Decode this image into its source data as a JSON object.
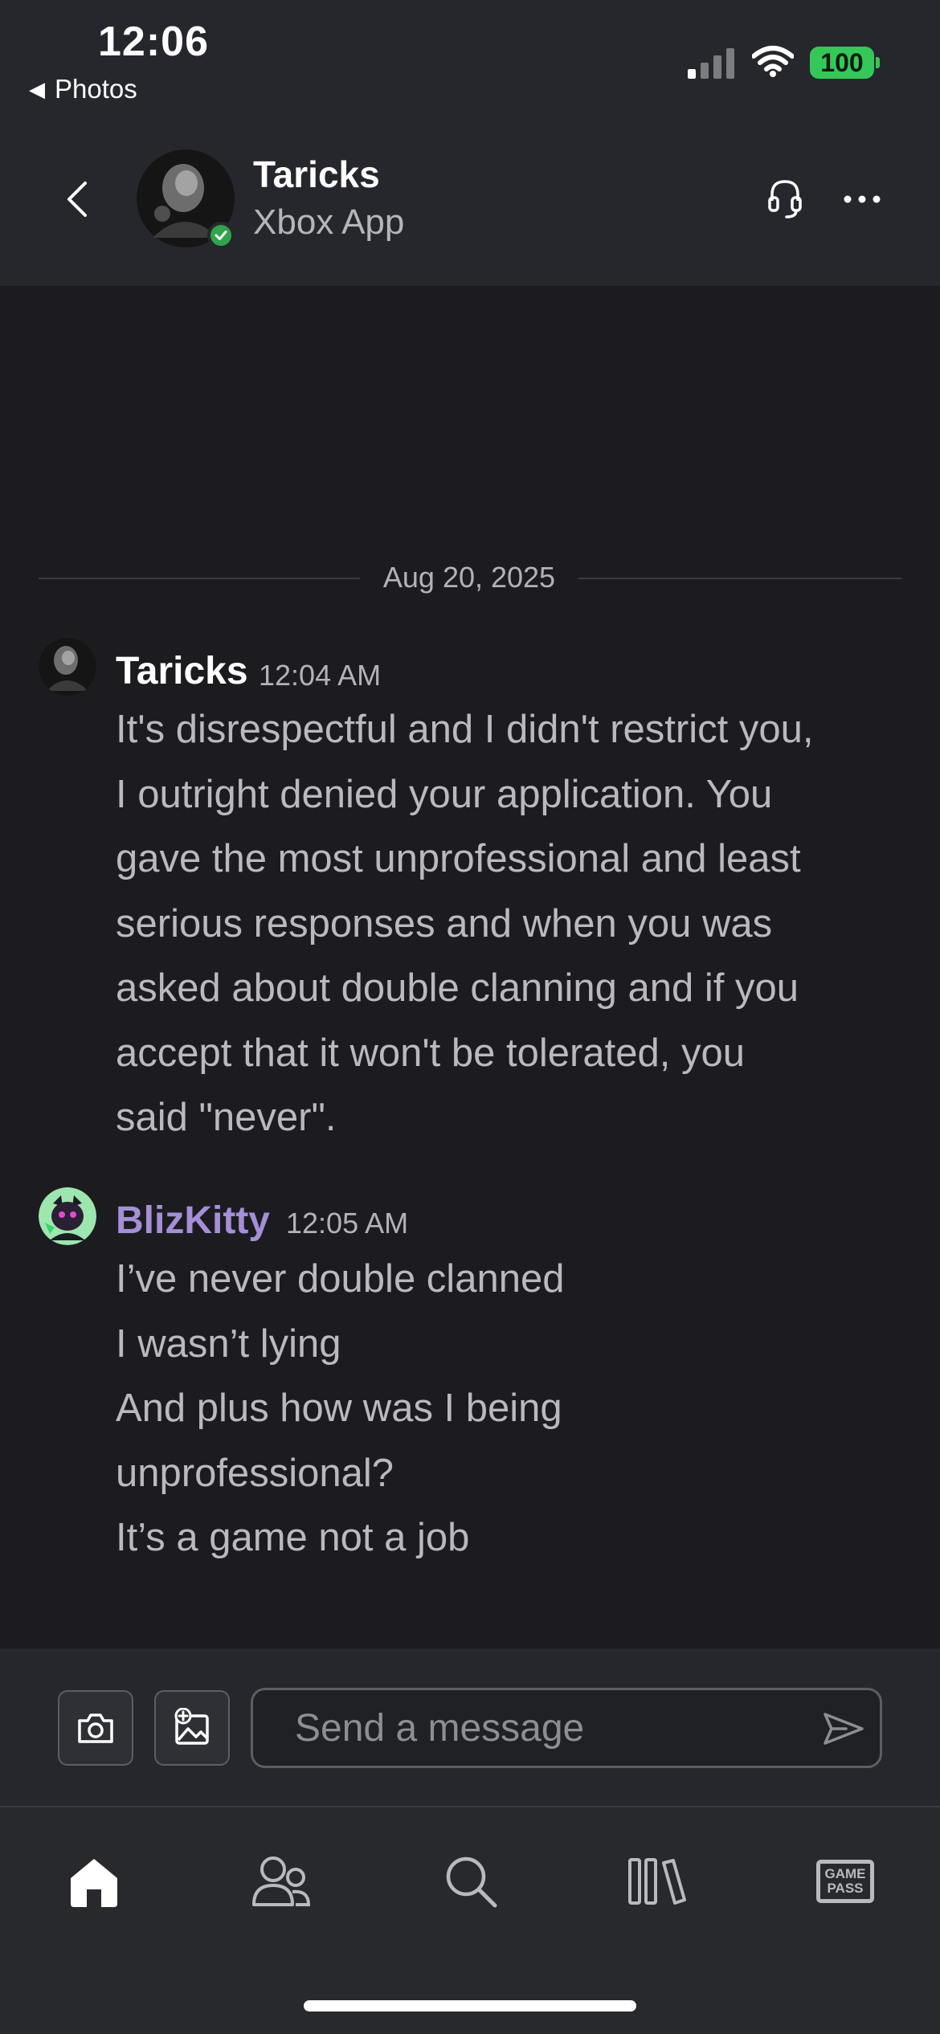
{
  "status_bar": {
    "time": "12:06",
    "back_app": "Photos",
    "battery": "100"
  },
  "header": {
    "name": "Taricks",
    "subtitle": "Xbox App"
  },
  "conversation": {
    "date_divider": "Aug 20, 2025",
    "messages": [
      {
        "author": "Taricks",
        "time": "12:04 AM",
        "lines": [
          "It's disrespectful and I didn't restrict you,",
          "I outright denied your application. You",
          "gave the most unprofessional and least",
          "serious responses and when you was",
          "asked about double clanning and if you",
          "accept that it won't be tolerated, you",
          "said \"never\"."
        ]
      },
      {
        "author": "BlizKitty",
        "author_color": "#a58fd6",
        "time": "12:05 AM",
        "lines": [
          "I’ve never double clanned",
          "I wasn’t lying",
          "And plus how was I being",
          "unprofessional?",
          "It’s a game not a job"
        ]
      }
    ]
  },
  "composer": {
    "placeholder": "Send a message"
  },
  "nav": {
    "items": [
      "home-icon",
      "friends-icon",
      "search-icon",
      "library-icon",
      "game-pass-icon"
    ],
    "gamepass_line1": "GAME",
    "gamepass_line2": "PASS"
  },
  "colors": {
    "accent_green": "#36c759",
    "online": "#2fa44b",
    "blizkitty": "#a58fd6"
  }
}
